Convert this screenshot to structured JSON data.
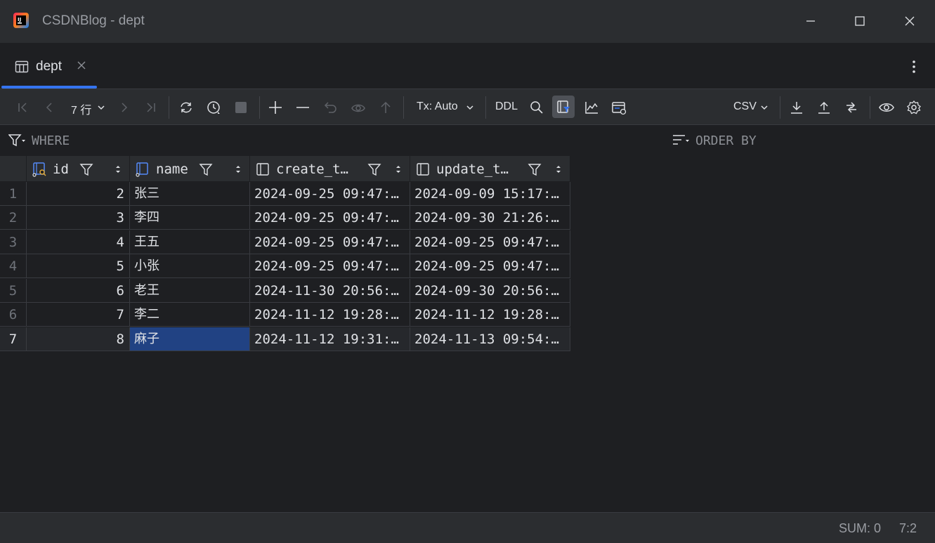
{
  "window": {
    "title": "CSDNBlog - dept"
  },
  "tabs": [
    {
      "label": "dept"
    }
  ],
  "toolbar": {
    "rows_label": "7 行",
    "tx_label": "Tx: Auto",
    "ddl_label": "DDL",
    "export_format": "CSV"
  },
  "filters": {
    "where_label": "WHERE",
    "order_label": "ORDER BY"
  },
  "columns": [
    {
      "name": "id"
    },
    {
      "name": "name"
    },
    {
      "name": "create_t…"
    },
    {
      "name": "update_t…"
    }
  ],
  "rows": [
    {
      "n": "1",
      "id": "2",
      "name": "张三",
      "create": "2024-09-25 09:47:…",
      "update": "2024-09-09 15:17:…"
    },
    {
      "n": "2",
      "id": "3",
      "name": "李四",
      "create": "2024-09-25 09:47:…",
      "update": "2024-09-30 21:26:…"
    },
    {
      "n": "3",
      "id": "4",
      "name": "王五",
      "create": "2024-09-25 09:47:…",
      "update": "2024-09-25 09:47:…"
    },
    {
      "n": "4",
      "id": "5",
      "name": "小张",
      "create": "2024-09-25 09:47:…",
      "update": "2024-09-25 09:47:…"
    },
    {
      "n": "5",
      "id": "6",
      "name": "老王",
      "create": "2024-11-30 20:56:…",
      "update": "2024-09-30 20:56:…"
    },
    {
      "n": "6",
      "id": "7",
      "name": "李二",
      "create": "2024-11-12 19:28:…",
      "update": "2024-11-12 19:28:…"
    },
    {
      "n": "7",
      "id": "8",
      "name": "麻子",
      "create": "2024-11-12 19:31:…",
      "update": "2024-11-13 09:54:…"
    }
  ],
  "status": {
    "sum": "SUM: 0",
    "position": "7:2"
  },
  "colors": {
    "accent": "#3574f0",
    "selection": "#214283",
    "background": "#1e1f22",
    "panel": "#2b2d30"
  }
}
